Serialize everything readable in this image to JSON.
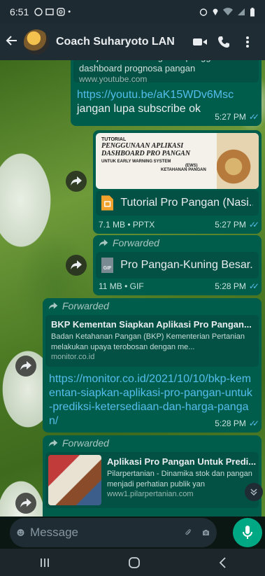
{
  "status": {
    "time": "6:51"
  },
  "header": {
    "contact_name": "Coach Suharyoto LAN"
  },
  "colors": {
    "outgoing_bubble": "#005c4b",
    "link": "#53bdeb",
    "accent": "#00a884"
  },
  "messages": [
    {
      "preview_text": "Menjelaskan tentang cara penggunaan dashboard prognosa pangan",
      "preview_domain": "www.youtube.com",
      "link": "https://youtu.be/aK15WDv6Msc",
      "text": "jangan lupa subscribe ok",
      "time": "5:27 PM"
    },
    {
      "thumb_label": "TUTORIAL",
      "thumb_title1": "PENGGUNAAN APLIKASI",
      "thumb_title2": "DASHBOARD PRO PANGAN",
      "thumb_sub1": "UNTUK EARLY WARNING SYSTEM",
      "thumb_sub2": "(EWS)",
      "thumb_sub3": "KETAHANAN PANGAN",
      "file_name": "Tutorial Pro Pangan (Nasi...",
      "file_info": "7.1 MB • PPTX",
      "time": "5:27 PM"
    },
    {
      "forwarded": "Forwarded",
      "file_icon": "GIF",
      "file_name": "Pro Pangan-Kuning Besar...",
      "file_info": "11 MB • GIF",
      "time": "5:28 PM"
    },
    {
      "forwarded": "Forwarded",
      "preview_title": "BKP Kementan Siapkan Aplikasi Pro Pangan...",
      "preview_desc": "Badan Ketahanan Pangan (BKP) Kementerian Pertanian melakukan upaya terobosan dengan me...",
      "preview_domain": "monitor.co.id",
      "link": "https://monitor.co.id/2021/10/10/bkp-kementan-siapkan-aplikasi-pro-pangan-untuk-prediksi-ketersediaan-dan-harga-pangan/",
      "time": "5:28 PM"
    },
    {
      "forwarded": "Forwarded",
      "preview_title": "Aplikasi Pro Pangan Untuk Predi...",
      "preview_desc": "Pilarpertanian - Dinamika stok dan pangan menjadi perhatian publik yan",
      "preview_domain": "www1.pilarpertanian.com"
    }
  ],
  "composer": {
    "placeholder": "Message"
  }
}
